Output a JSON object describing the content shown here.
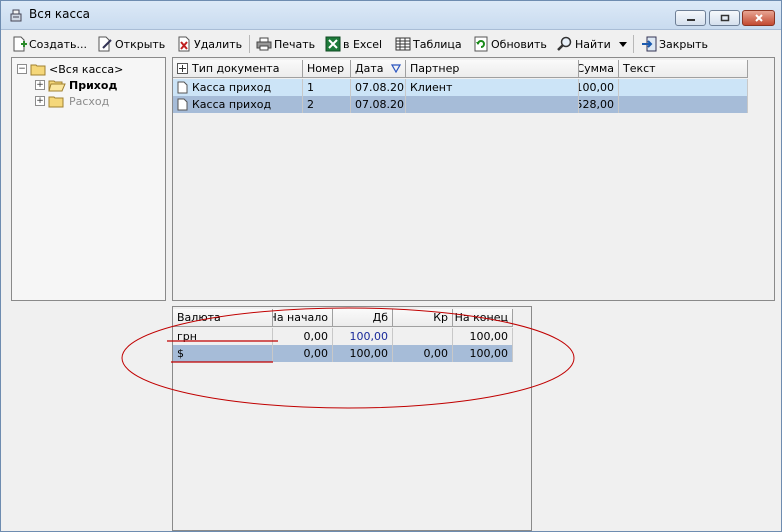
{
  "window": {
    "title": "Вся касса"
  },
  "toolbar": {
    "create": "Создать...",
    "open": "Открыть",
    "delete": "Удалить",
    "print": "Печать",
    "excel": "в Excel",
    "table": "Таблица",
    "refresh": "Обновить",
    "find": "Найти",
    "close": "Закрыть"
  },
  "tree": {
    "root": "<Вся касса>",
    "income": "Приход",
    "expense": "Расход"
  },
  "documents": {
    "columns": [
      "Тип документа",
      "Номер",
      "Дата",
      "Партнер",
      "Сумма",
      "Текст"
    ],
    "rows": [
      [
        "Касса приход",
        "1",
        "07.08.20",
        "Клиент",
        "100,00",
        ""
      ],
      [
        "Касса приход",
        "2",
        "07.08.20",
        "",
        "528,00",
        ""
      ]
    ]
  },
  "summary": {
    "columns": [
      "Валюта",
      "На начало",
      "Дб",
      "Кр",
      "На конец"
    ],
    "rows": [
      [
        "грн",
        "0,00",
        "100,00",
        "",
        "100,00"
      ],
      [
        "$",
        "0,00",
        "100,00",
        "0,00",
        "100,00"
      ]
    ]
  },
  "colors": {
    "selected_row": "#cce4f7",
    "active_row": "#a6bcd8",
    "annotation": "#c00000"
  }
}
